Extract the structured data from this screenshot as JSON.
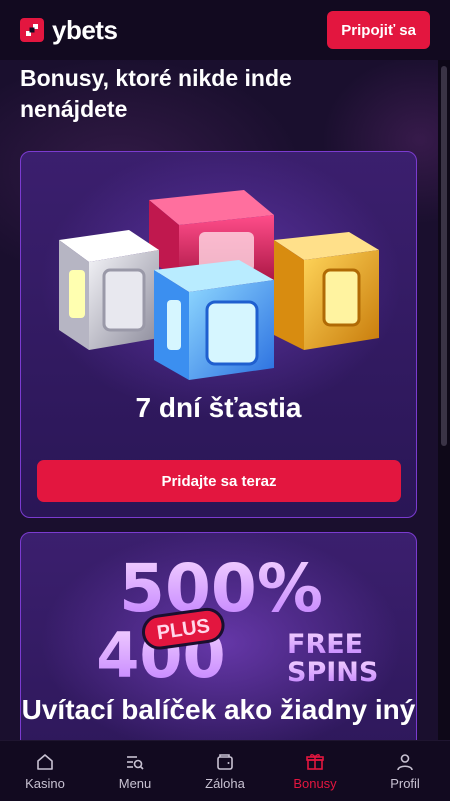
{
  "header": {
    "logo_text": "ybets",
    "connect_label": "Pripojiť sa",
    "logo_color": "#e3163f"
  },
  "page": {
    "title": "Bonusy, ktoré nikde inde nenájdete"
  },
  "cards": [
    {
      "title": "7 dní šťastia",
      "button_label": "Pridajte sa teraz",
      "image_icon": "cube-chests-icon"
    },
    {
      "promo_line1": "500%",
      "promo_plus": "PLUS",
      "promo_line2": "400",
      "promo_free": "FREE",
      "promo_spins": "SPINS",
      "title": "Uvítací balíček ako žiadny iný"
    }
  ],
  "nav": {
    "items": [
      {
        "label": "Kasino",
        "icon": "home-icon",
        "active": false
      },
      {
        "label": "Menu",
        "icon": "menu-search-icon",
        "active": false
      },
      {
        "label": "Záloha",
        "icon": "wallet-icon",
        "active": false
      },
      {
        "label": "Bonusy",
        "icon": "gift-icon",
        "active": true
      },
      {
        "label": "Profil",
        "icon": "user-icon",
        "active": false
      }
    ]
  },
  "colors": {
    "accent": "#e3163f",
    "background": "#1a0f2e",
    "card_border": "#7b3bd0"
  }
}
